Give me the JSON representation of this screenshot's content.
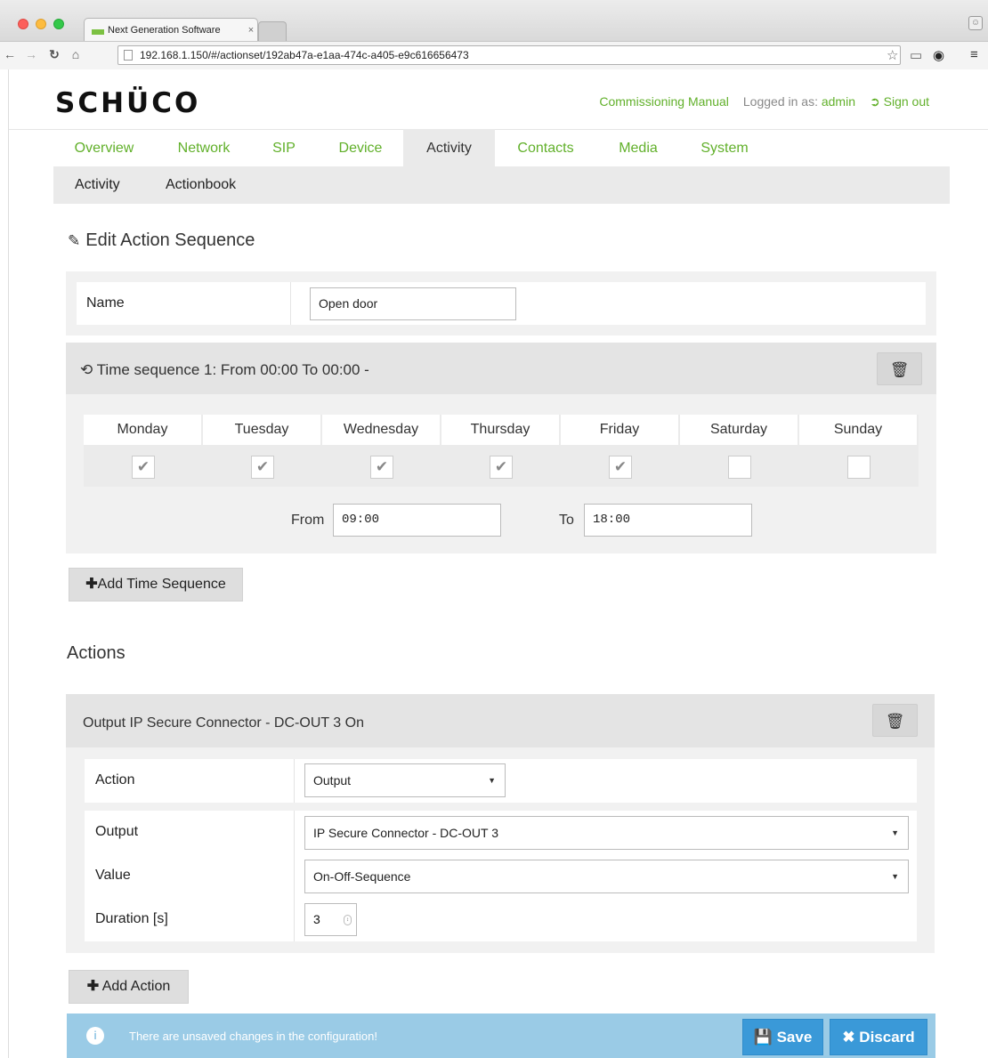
{
  "browser": {
    "tab_title": "Next Generation Software",
    "tab_close": "×",
    "url": "192.168.1.150/#/actionset/192ab47a-e1aa-474c-a405-e9c616656473",
    "icons": [
      "back-icon",
      "forward-icon",
      "reload-icon",
      "home-icon",
      "star-icon",
      "cast-icon",
      "extension-icon",
      "menu-icon",
      "profile-icon"
    ]
  },
  "header": {
    "logo": "SCHÜCO",
    "manual_link": "Commissioning Manual",
    "logged_in_label": "Logged in as:",
    "user": "admin",
    "sign_out": "Sign out"
  },
  "nav": {
    "items": [
      "Overview",
      "Network",
      "SIP",
      "Device",
      "Activity",
      "Contacts",
      "Media",
      "System"
    ],
    "active": "Activity",
    "sub_items": [
      "Activity",
      "Actionbook"
    ]
  },
  "edit": {
    "heading": "Edit Action Sequence",
    "name_label": "Name",
    "name_value": "Open door"
  },
  "time_sequence": {
    "title": "Time sequence 1: From 00:00 To 00:00 -",
    "days": [
      {
        "name": "Monday",
        "checked": true
      },
      {
        "name": "Tuesday",
        "checked": true
      },
      {
        "name": "Wednesday",
        "checked": true
      },
      {
        "name": "Thursday",
        "checked": true
      },
      {
        "name": "Friday",
        "checked": true
      },
      {
        "name": "Saturday",
        "checked": false
      },
      {
        "name": "Sunday",
        "checked": false
      }
    ],
    "check_mark": "✔",
    "from_label": "From",
    "from_value": "09:00",
    "to_label": "To",
    "to_value": "18:00",
    "add_button": "Add Time Sequence"
  },
  "actions": {
    "heading": "Actions",
    "item_title": "Output IP Secure Connector - DC-OUT 3 On",
    "fields": {
      "action_label": "Action",
      "action_value": "Output",
      "output_label": "Output",
      "output_value": "IP Secure Connector - DC-OUT 3",
      "value_label": "Value",
      "value_value": "On-Off-Sequence",
      "duration_label": "Duration [s]",
      "duration_value": "3"
    },
    "add_button": "Add Action"
  },
  "notice": {
    "message": "There are unsaved changes in the configuration!",
    "save": "Save",
    "discard": "Discard"
  },
  "colors": {
    "accent_green": "#61b02a",
    "notice_bg": "#9acbe6",
    "button_blue": "#3a99d8"
  }
}
